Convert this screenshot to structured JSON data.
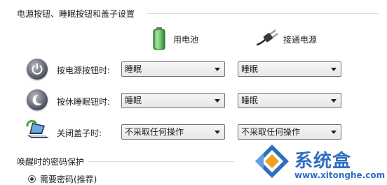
{
  "section": {
    "title": "电源按钮、睡眠按钮和盖子设置"
  },
  "columns": {
    "battery_label": "用电池",
    "plugged_label": "接通电源"
  },
  "rows": [
    {
      "label": "按电源按钮时:",
      "battery_value": "睡眠",
      "plugged_value": "睡眠",
      "icon": "power-button-icon"
    },
    {
      "label": "按休睡眠钮时:",
      "battery_value": "睡眠",
      "plugged_value": "睡眠",
      "icon": "sleep-button-icon"
    },
    {
      "label": "关闭盖子时:",
      "battery_value": "不采取任何操作",
      "plugged_value": "不采取任何操作",
      "icon": "laptop-lid-icon"
    }
  ],
  "password_section": {
    "title": "唤醒时的密码保护",
    "option_label": "需要密码(推荐)",
    "option_selected": true
  },
  "watermark": {
    "brand": "系统盒",
    "url": "www.xitonghe.com"
  },
  "colors": {
    "battery_green": "#3ca83c",
    "watermark_blue": "#2f6fc0",
    "watermark_orange": "#f0a020"
  }
}
